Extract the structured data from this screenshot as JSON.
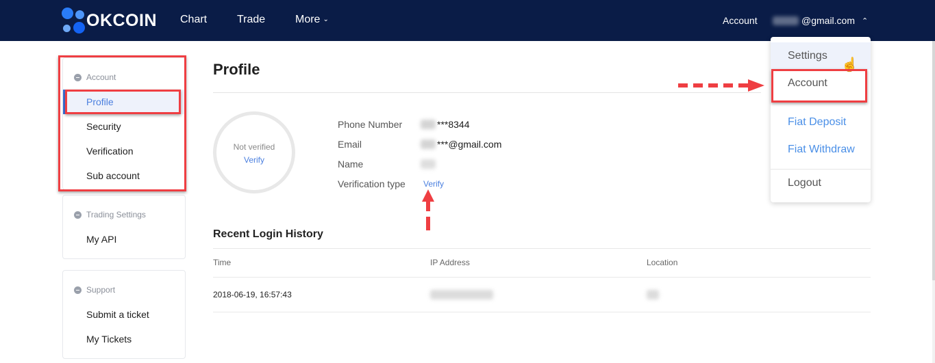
{
  "header": {
    "brand": "OKCOIN",
    "nav": [
      {
        "label": "Chart"
      },
      {
        "label": "Trade"
      },
      {
        "label": "More",
        "icon": "chevron-down-icon"
      }
    ],
    "account_label": "Account",
    "user_email": "@gmail.com",
    "user_icon": "chevron-up-icon"
  },
  "user_menu": {
    "items": [
      {
        "label": "Settings"
      },
      {
        "label": "Account"
      },
      {
        "label": "Fiat Deposit"
      },
      {
        "label": "Fiat Withdraw"
      },
      {
        "label": "Logout"
      }
    ],
    "colors": {
      "link": "#4a8fe7",
      "hover_bg": "#eef2fb"
    }
  },
  "sidebar": {
    "groups": [
      {
        "title": "Account",
        "items": [
          {
            "label": "Profile",
            "active": true
          },
          {
            "label": "Security"
          },
          {
            "label": "Verification"
          },
          {
            "label": "Sub account"
          }
        ]
      },
      {
        "title": "Trading Settings",
        "items": [
          {
            "label": "My API"
          }
        ]
      },
      {
        "title": "Support",
        "items": [
          {
            "label": "Submit a ticket"
          },
          {
            "label": "My Tickets"
          }
        ]
      }
    ]
  },
  "profile": {
    "title": "Profile",
    "status": "Not verified",
    "status_action": "Verify",
    "fields": [
      {
        "label": "Phone Number",
        "value": "***8344"
      },
      {
        "label": "Email",
        "value": "***@gmail.com"
      },
      {
        "label": "Name",
        "value": ""
      },
      {
        "label": "Verification type",
        "value": "Verify"
      }
    ]
  },
  "login_history": {
    "title": "Recent Login History",
    "columns": [
      "Time",
      "IP Address",
      "Location"
    ],
    "rows": [
      {
        "time": "2018-06-19, 16:57:43",
        "ip": "",
        "location": ""
      }
    ]
  },
  "colors": {
    "header_bg": "#0a1c47",
    "accent": "#4a7fdf",
    "annotation": "#ef3e42"
  }
}
